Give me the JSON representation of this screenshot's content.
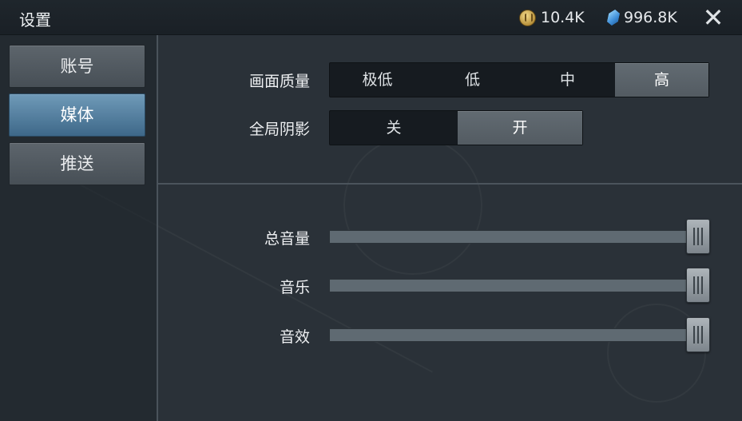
{
  "header": {
    "title": "设置",
    "gold": "10.4K",
    "gems": "996.8K",
    "close_glyph": "✕"
  },
  "sidebar": {
    "tabs": [
      {
        "label": "账号",
        "active": false
      },
      {
        "label": "媒体",
        "active": true
      },
      {
        "label": "推送",
        "active": false
      }
    ]
  },
  "graphics": {
    "quality_label": "画面质量",
    "quality_options": [
      "极低",
      "低",
      "中",
      "高"
    ],
    "quality_selected": "高",
    "shadow_label": "全局阴影",
    "shadow_options": [
      "关",
      "开"
    ],
    "shadow_selected": "开"
  },
  "audio": {
    "master_label": "总音量",
    "master_value": 1.0,
    "music_label": "音乐",
    "music_value": 1.0,
    "sfx_label": "音效",
    "sfx_value": 1.0
  },
  "colors": {
    "accent_active_tab": "#4f7ea3",
    "background": "#2a3138"
  }
}
